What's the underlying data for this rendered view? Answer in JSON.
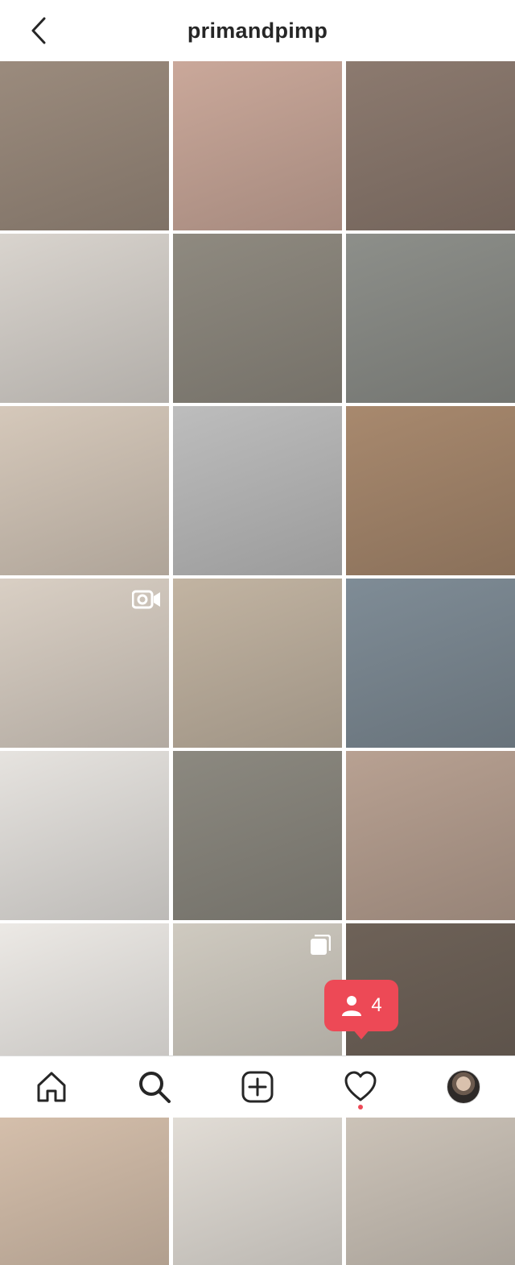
{
  "header": {
    "username": "primandpimp"
  },
  "icons": {
    "back": "chevron-left-icon",
    "video": "igtv-video-icon",
    "multi": "carousel-icon",
    "home": "home-icon",
    "search": "search-icon",
    "add": "add-post-icon",
    "activity": "heart-icon",
    "profile": "profile-avatar",
    "follower": "person-icon"
  },
  "notification": {
    "count": "4"
  },
  "colors": {
    "accent": "#ed4956",
    "text": "#262626"
  },
  "grid": {
    "rows": [
      [
        "#9b8b7d",
        "#caa89a",
        "#8c7a6f"
      ],
      [
        "#d9d4ce",
        "#8f8a80",
        "#8d8f8a"
      ],
      [
        "#d5c8ba",
        "#bdbdbd",
        "#a8896e"
      ],
      [
        "#d9cfc4",
        "#c2b4a2",
        "#7f8c96"
      ],
      [
        "#e6e3df",
        "#8c8980",
        "#b8a192"
      ],
      [
        "#ece9e5",
        "#cfcac0",
        "#6e6258"
      ],
      [
        "#d8c2ae",
        "#e5e0d9",
        "#cfc6bb"
      ]
    ]
  }
}
